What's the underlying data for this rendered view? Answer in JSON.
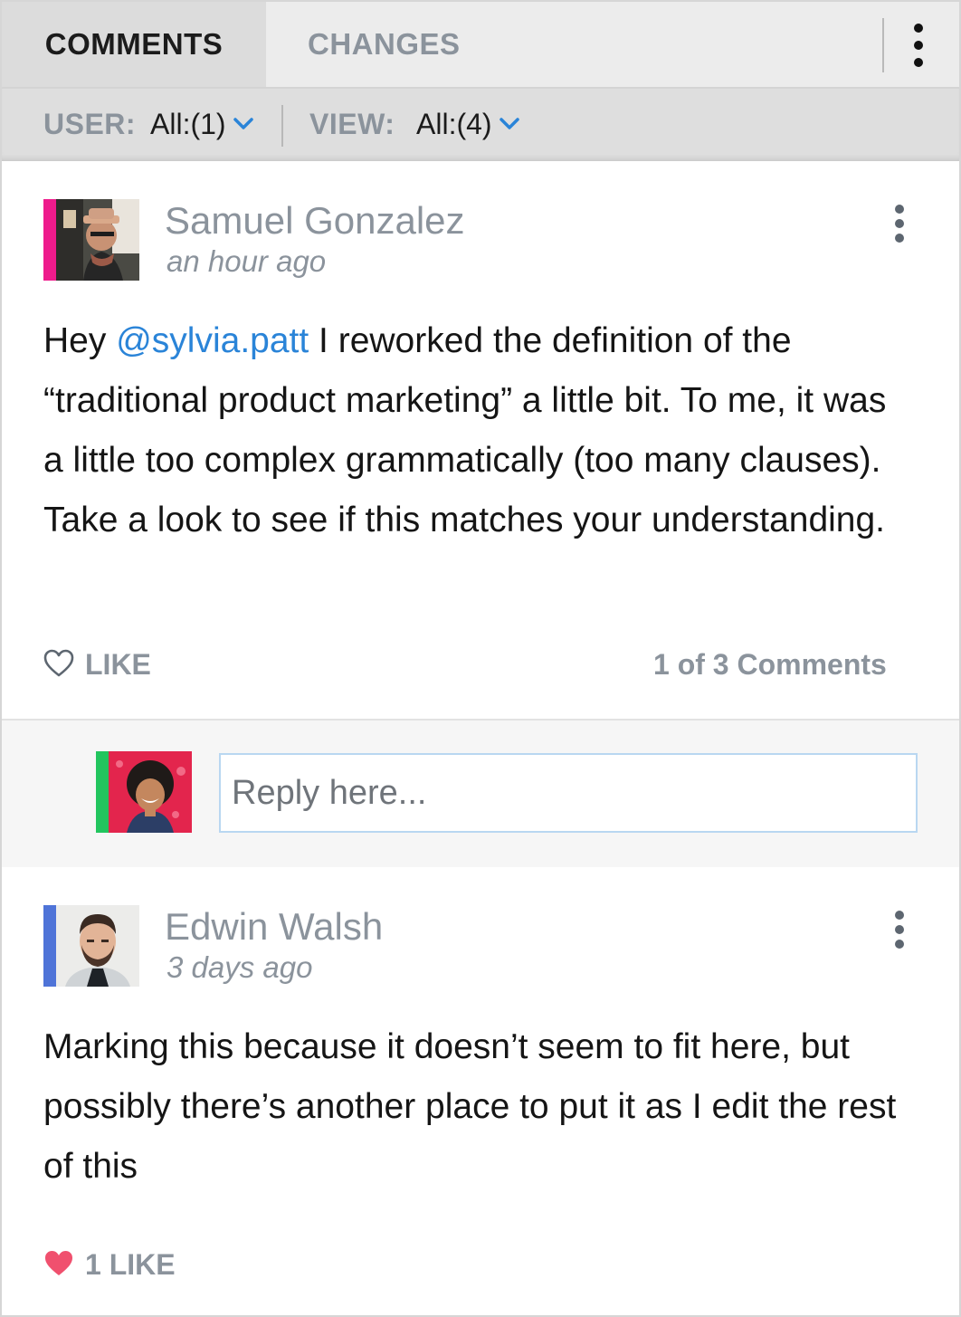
{
  "tabs": {
    "comments_label": "COMMENTS",
    "changes_label": "CHANGES",
    "menu_icon": "kebab-vertical-icon"
  },
  "filters": {
    "user_label": "USER:",
    "user_value": "All:(1)",
    "view_label": "VIEW:",
    "view_value": "All:(4)",
    "chevron_icon": "chevron-down-icon",
    "chevron_color": "#2a84d8"
  },
  "comments": [
    {
      "author": "Samuel Gonzalez",
      "time": "an hour ago",
      "accent_color": "#ee1b8c",
      "text_before_mention": "Hey ",
      "mention": "@sylvia.patt",
      "text_after_mention": " I reworked the definition of the “traditional product marketing” a little bit. To me, it was a little too complex grammatically (too many clauses). Take a look to see if this matches your understanding.",
      "like_label": "LIKE",
      "like_icon": "heart-outline-icon",
      "comment_count": "1 of 3  Comments"
    },
    {
      "author": "Edwin Walsh",
      "time": "3 days ago",
      "accent_color": "#4f74d8",
      "text": "Marking this because it doesn’t seem to fit here, but possibly there’s another place to put it as I edit the rest of this",
      "like_label": "1 LIKE",
      "like_icon": "heart-filled-icon",
      "like_color": "#f0506e"
    }
  ],
  "reply": {
    "placeholder": "Reply here...",
    "accent_color": "#22c55e"
  }
}
